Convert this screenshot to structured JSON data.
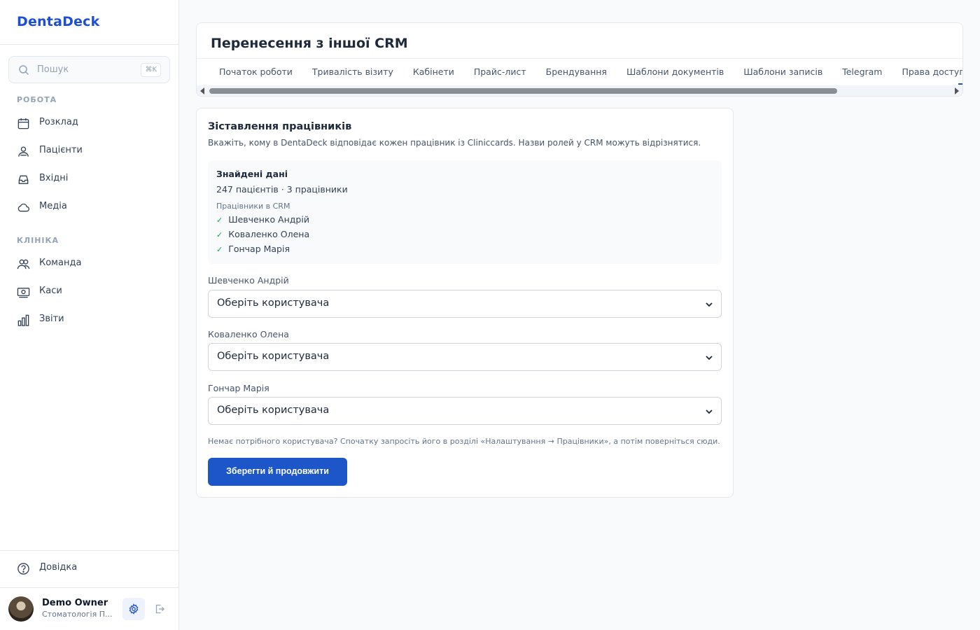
{
  "app": {
    "brand": "DentaDeck"
  },
  "sidebar": {
    "search": {
      "placeholder": "Пошук",
      "shortcut": "⌘K"
    },
    "sections": [
      {
        "label": "РОБОТА",
        "items": [
          {
            "label": "Розклад",
            "icon": "calendar-icon"
          },
          {
            "label": "Пацієнти",
            "icon": "patients-icon"
          },
          {
            "label": "Вхідні",
            "icon": "inbox-icon"
          },
          {
            "label": "Медіа",
            "icon": "cloud-icon"
          }
        ]
      },
      {
        "label": "КЛІНІКА",
        "items": [
          {
            "label": "Команда",
            "icon": "team-icon"
          },
          {
            "label": "Каси",
            "icon": "cash-icon"
          },
          {
            "label": "Звіти",
            "icon": "reports-icon"
          }
        ]
      }
    ],
    "help": {
      "label": "Довідка",
      "icon": "help-icon"
    },
    "user": {
      "name": "Demo Owner",
      "clinic": "Стоматологія П..."
    }
  },
  "header": {
    "title": "Перенесення з іншої CRM",
    "tabs": [
      "Початок роботи",
      "Тривалість візиту",
      "Кабінети",
      "Прайс-лист",
      "Брендування",
      "Шаблони документів",
      "Шаблони записів",
      "Telegram",
      "Права доступу"
    ]
  },
  "mapping": {
    "title": "Зіставлення працівників",
    "description": "Вкажіть, кому в DentaDeck відповідає кожен працівник із Cliniccards. Назви ролей у CRM можуть відрізнятися.",
    "found": {
      "title": "Знайдені дані",
      "counts": "247 пацієнтів · 3 працівники",
      "staff_label": "Працівники в CRM",
      "staff": [
        "Шевченко Андрій",
        "Коваленко Олена",
        "Гончар Марія"
      ]
    },
    "fields": [
      {
        "label": "Шевченко Андрій",
        "value": "Оберіть користувача"
      },
      {
        "label": "Коваленко Олена",
        "value": "Оберіть користувача"
      },
      {
        "label": "Гончар Марія",
        "value": "Оберіть користувача"
      }
    ],
    "hint": "Немає потрібного користувача? Спочатку запросіть його в розділі «Налаштування → Працівники», а потім поверніться сюди.",
    "save_label": "Зберегти й продовжити"
  },
  "colors": {
    "brand": "#1d4ed8",
    "primary_button": "#1d56c9",
    "check": "#16a34a"
  }
}
